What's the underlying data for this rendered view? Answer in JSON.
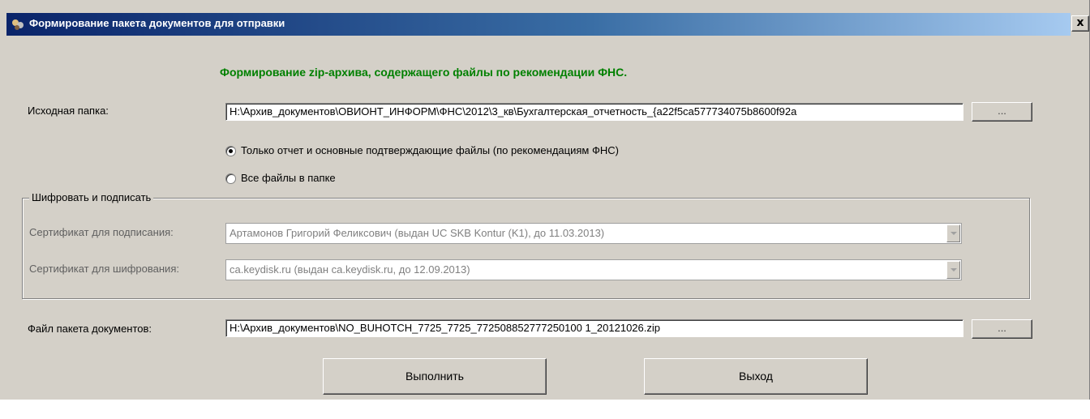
{
  "window": {
    "title": "Формирование пакета документов для отправки",
    "close_label": "x",
    "heading": "Формирование zip-архива, содержащего файлы по рекомендации ФНС."
  },
  "source": {
    "label": "Исходная папка:",
    "value": "H:\\Архив_документов\\ОВИОНТ_ИНФОРМ\\ФНС\\2012\\3_кв\\Бухгалтерская_отчетность_{a22f5ca577734075b8600f92a",
    "browse_label": "..."
  },
  "options": {
    "only_report": {
      "label": "Только отчет и основные подтверждающие файлы (по рекомендациям ФНС)",
      "selected": true
    },
    "all_files": {
      "label": "Все файлы в папке",
      "selected": false
    }
  },
  "crypto": {
    "group_title": "Шифровать и подписать",
    "sign_label": "Сертификат для подписания:",
    "sign_value": "Артамонов Григорий Феликсович (выдан UC SKB Kontur (K1), до 11.03.2013)",
    "encrypt_label": "Сертификат для шифрования:",
    "encrypt_value": "ca.keydisk.ru (выдан ca.keydisk.ru, до 12.09.2013)"
  },
  "package": {
    "label": "Файл пакета документов:",
    "value": "H:\\Архив_документов\\NO_BUHOTCH_7725_7725_772508852777250100 1_20121026.zip",
    "browse_label": "..."
  },
  "actions": {
    "run_label": "Выполнить",
    "exit_label": "Выход"
  },
  "colors": {
    "dialog_bg": "#d4d0c8",
    "title_start": "#0a246a",
    "heading": "#008000"
  }
}
